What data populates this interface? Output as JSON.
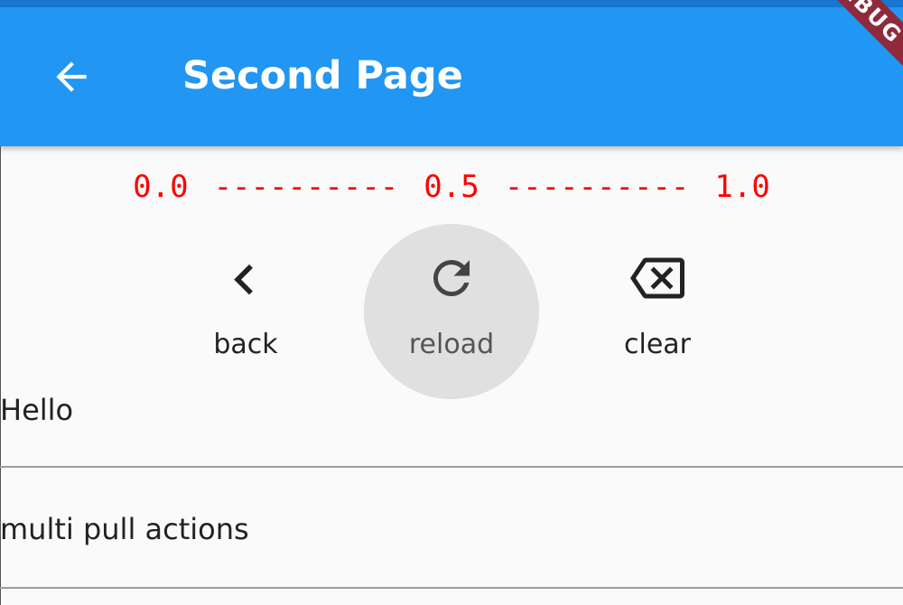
{
  "app_bar": {
    "title": "Second Page",
    "back_icon": "arrow-back-icon",
    "debug_banner": "DEBUG",
    "color": "#2196f3"
  },
  "pull_progress": {
    "start": "0.0",
    "dash1": "----------",
    "mid": "0.5",
    "dash2": "----------",
    "end": "1.0",
    "color": "#ff0000"
  },
  "actions": [
    {
      "label": "back",
      "icon": "chevron-left-icon"
    },
    {
      "label": "reload",
      "icon": "refresh-icon",
      "highlighted": true
    },
    {
      "label": "clear",
      "icon": "backspace-icon"
    }
  ],
  "list": {
    "items": [
      {
        "label": "Hello"
      },
      {
        "label": "multi pull actions"
      }
    ]
  }
}
